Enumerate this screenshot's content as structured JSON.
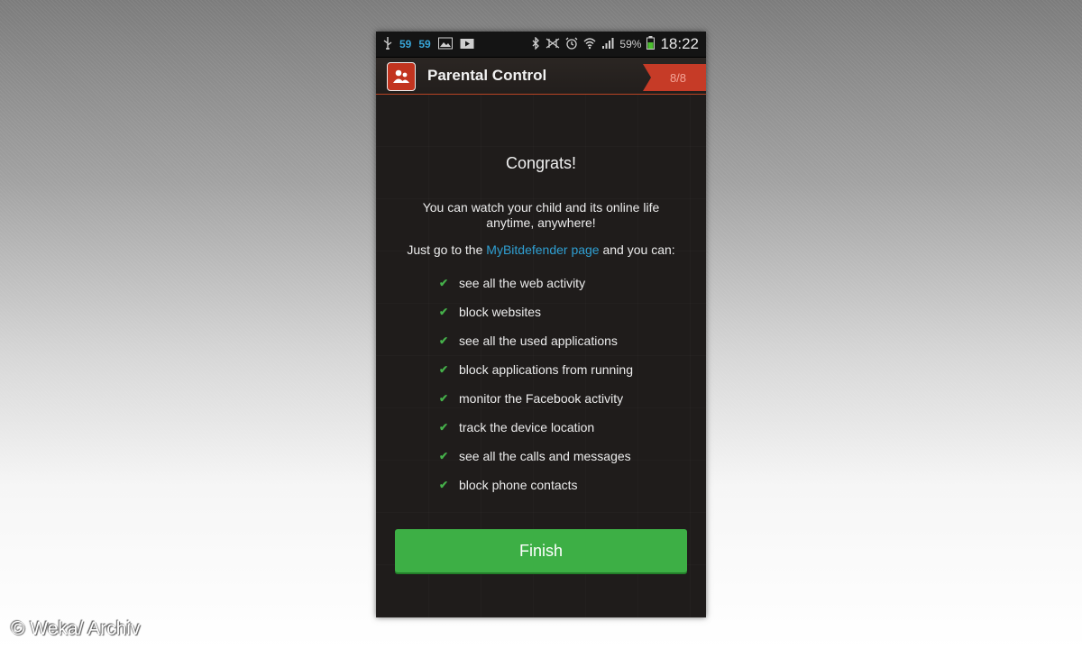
{
  "status_bar": {
    "notif_1": "59",
    "notif_2": "59",
    "battery": "59%",
    "time": "18:22",
    "icons": [
      "usb-icon",
      "image-icon",
      "play-store-icon",
      "bluetooth-icon",
      "nfc-icon",
      "alarm-icon",
      "wifi-icon",
      "signal-icon",
      "battery-icon"
    ]
  },
  "app_bar": {
    "title": "Parental Control",
    "step": "8/8",
    "icon": "parental-control-app-icon"
  },
  "content": {
    "heading": "Congrats!",
    "intro": "You can watch your child and its online life anytime, anywhere!",
    "instruction_prefix": "Just go to the ",
    "link_text": "MyBitdefender page",
    "instruction_suffix": " and you can:",
    "features": [
      "see all the web activity",
      "block websites",
      "see all the used applications",
      "block applications from running",
      "monitor the Facebook activity",
      "track the device location",
      "see all the calls and messages",
      "block phone contacts"
    ]
  },
  "finish_button": {
    "label": "Finish"
  },
  "watermark": "© Weka/ Archiv",
  "colors": {
    "accent": "#3daf45",
    "ribbon": "#c63b27",
    "link": "#2f9fd2",
    "background": "#1f1c1b"
  }
}
